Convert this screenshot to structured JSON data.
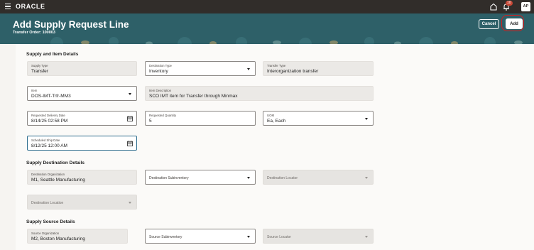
{
  "topbar": {
    "brand": "ORACLE",
    "notifications": "10",
    "avatar": "AP"
  },
  "header": {
    "title": "Add Supply Request Line",
    "subtitle": "Transfer Order: 100003",
    "cancel": "Cancel",
    "add": "Add"
  },
  "sections": {
    "item": "Supply and Item Details",
    "destination": "Supply Destination Details",
    "source": "Supply Source Details"
  },
  "fields": {
    "supply_type": {
      "label": "Supply Type",
      "value": "Transfer"
    },
    "destination_type": {
      "label": "Destination Type",
      "value": "Inventory"
    },
    "transfer_type": {
      "label": "Transfer Type",
      "value": "Interorganization transfer"
    },
    "item": {
      "label": "Item",
      "value": "DOS-IMT-Trfr-MM3"
    },
    "item_description": {
      "label": "Item Description",
      "value": "SCO IMT item for Transfer through Minmax"
    },
    "requested_delivery_date": {
      "label": "Requested Delivery Date",
      "value": "8/14/25 02:58 PM"
    },
    "requested_quantity": {
      "label": "Requested Quantity",
      "value": "5"
    },
    "uom": {
      "label": "UOM",
      "value": "Ea, Each"
    },
    "scheduled_ship_date": {
      "label": "Scheduled Ship Date",
      "value": "8/12/25 12:00 AM"
    },
    "destination_organization": {
      "label": "Destination Organization",
      "value": "M1, Seattle Manufacturing"
    },
    "destination_subinventory": {
      "placeholder": "Destination Subinventory"
    },
    "destination_locator": {
      "placeholder": "Destination Locator"
    },
    "destination_location": {
      "placeholder": "Destination Location"
    },
    "source_organization": {
      "label": "Source Organization",
      "value": "M2, Boston Manufacturing"
    },
    "source_subinventory": {
      "placeholder": "Source Subinventory"
    },
    "source_locator": {
      "placeholder": "Source Locator"
    }
  },
  "colors": {
    "topbar": "#312d2a",
    "header": "#2e6068",
    "highlight_ring": "#d41e1e",
    "focus_border": "#2e6d8e"
  }
}
